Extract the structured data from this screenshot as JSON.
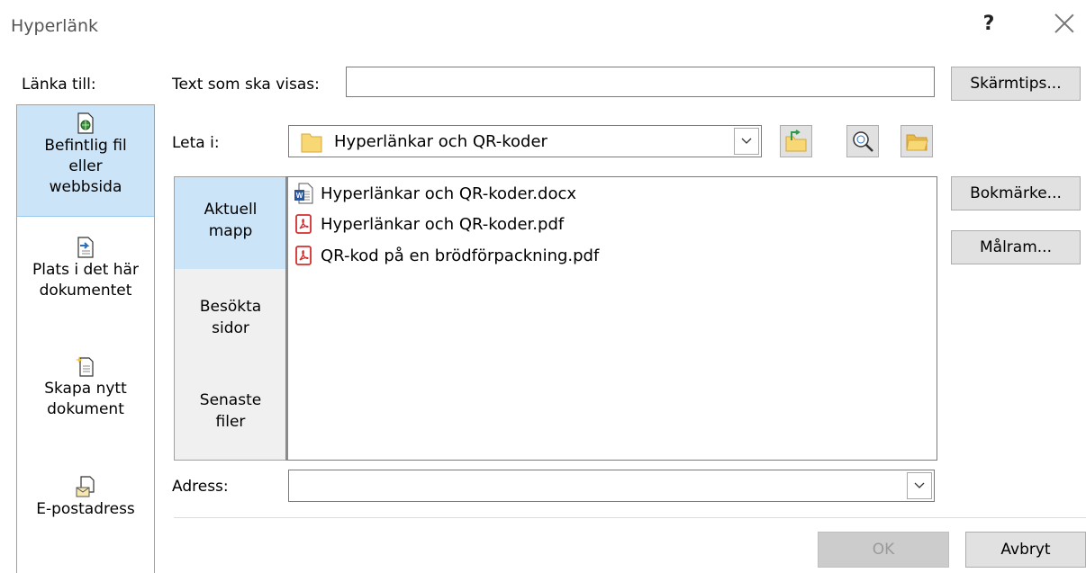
{
  "window": {
    "title": "Hyperlänk",
    "help_label": "?"
  },
  "link_to": {
    "label": "Länka till:",
    "items": [
      {
        "line1": "Befintlig fil",
        "line2": "eller",
        "line3": "webbsida",
        "selected": true
      },
      {
        "line1": "Plats i det här",
        "line2": "dokumentet"
      },
      {
        "line1": "Skapa nytt",
        "line2": "dokument"
      },
      {
        "line1": "E-postadress"
      }
    ]
  },
  "text_to_display": {
    "label": "Text som ska visas:",
    "value": ""
  },
  "buttons": {
    "screentip": "Skärmtips...",
    "bookmark": "Bokmärke...",
    "target_frame": "Målram...",
    "ok": "OK",
    "cancel": "Avbryt"
  },
  "look_in": {
    "label": "Leta i:",
    "value": "Hyperlänkar och QR-koder"
  },
  "nav": {
    "items": [
      {
        "line1": "Aktuell",
        "line2": "mapp",
        "selected": true
      },
      {
        "line1": "Besökta",
        "line2": "sidor"
      },
      {
        "line1": "Senaste",
        "line2": "filer"
      }
    ]
  },
  "files": [
    {
      "name": "Hyperlänkar och QR-koder.docx",
      "type": "word-doc-icon"
    },
    {
      "name": "Hyperlänkar och QR-koder.pdf",
      "type": "pdf-icon"
    },
    {
      "name": "QR-kod på en brödförpackning.pdf",
      "type": "pdf-icon"
    }
  ],
  "address": {
    "label": "Adress:",
    "value": ""
  },
  "colors": {
    "selected": "#cce4f7",
    "button": "#e1e1e1",
    "disabled_button": "#cccccc",
    "folder": "#f8d775"
  }
}
